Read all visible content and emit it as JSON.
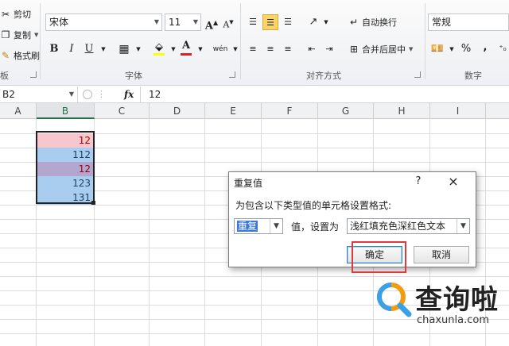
{
  "ribbon": {
    "clipboard": {
      "cut": "剪切",
      "copy": "复制",
      "format_painter": "格式刷",
      "group_label_partial": "板"
    },
    "font": {
      "font_name": "宋体",
      "font_size": "11",
      "grow": "A",
      "shrink": "A",
      "bold": "B",
      "italic": "I",
      "underline": "U",
      "font_color_letter": "A",
      "phonetic": "wén",
      "group_label": "字体"
    },
    "alignment": {
      "wrap_text": "自动换行",
      "merge_center": "合并后居中",
      "group_label": "对齐方式"
    },
    "number": {
      "format": "常规",
      "percent": "%",
      "comma": ",",
      "group_label": "数字"
    }
  },
  "formula_bar": {
    "name_box": "B2",
    "fx": "fx",
    "content": "12"
  },
  "sheet": {
    "columns": [
      "A",
      "B",
      "C",
      "D",
      "E",
      "F",
      "G",
      "H",
      "I"
    ],
    "selected_column": "B",
    "cells": [
      {
        "value": "12",
        "bg": "#f8c7cd",
        "color": "#9c0006"
      },
      {
        "value": "112",
        "bg": "#a9cdef",
        "color": "#1f3f66"
      },
      {
        "value": "12",
        "bg": "#b3a6cf",
        "color": "#9c0006"
      },
      {
        "value": "123",
        "bg": "#a9cdef",
        "color": "#1f3f66"
      },
      {
        "value": "131",
        "bg": "#a9cdef",
        "color": "#1f3f66"
      }
    ]
  },
  "dialog": {
    "title": "重复值",
    "help": "?",
    "close": "×",
    "prompt": "为包含以下类型值的单元格设置格式:",
    "type_value": "重复",
    "middle_label": "值，设置为",
    "format_value": "浅红填充色深红色文本",
    "ok": "确定",
    "cancel": "取消"
  },
  "watermark": {
    "name": "查询啦",
    "url": "chaxunla.com"
  },
  "colors": {
    "accent_green": "#217346",
    "highlight_red": "#e0393a",
    "selection_blue": "#3b78d8"
  }
}
